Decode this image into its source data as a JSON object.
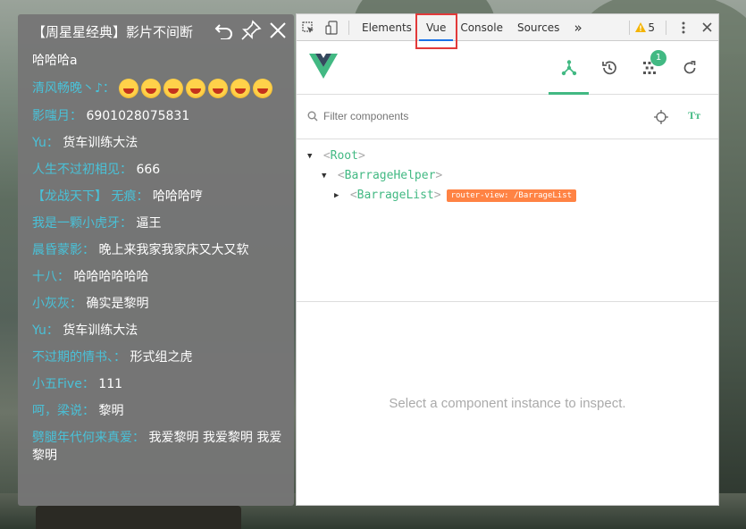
{
  "barrage": {
    "title": "【周星星经典】影片不间断",
    "messages": [
      {
        "user": "",
        "text": "哈哈哈a",
        "emojis": 0
      },
      {
        "user": "清风畅晚丶♪：",
        "text": "",
        "emojis": 7
      },
      {
        "user": "影嗤月：",
        "text": "6901028075831",
        "emojis": 0
      },
      {
        "user": "Yu：",
        "text": "货车训练大法",
        "emojis": 0
      },
      {
        "user": "人生不过初相见：",
        "text": "666",
        "emojis": 0
      },
      {
        "user": "【龙战天下】 无痕：",
        "text": "哈哈哈哼",
        "emojis": 0
      },
      {
        "user": "我是一颗小虎牙：",
        "text": "逼王",
        "emojis": 0
      },
      {
        "user": "晨昏蒙影：",
        "text": "晚上来我家我家床又大又软",
        "emojis": 0
      },
      {
        "user": "十八：",
        "text": "哈哈哈哈哈哈",
        "emojis": 0
      },
      {
        "user": "小灰灰：",
        "text": "确实是黎明",
        "emojis": 0
      },
      {
        "user": "Yu：",
        "text": "货车训练大法",
        "emojis": 0
      },
      {
        "user": "不过期的情书、：",
        "text": "形式组之虎",
        "emojis": 0
      },
      {
        "user": "小五Five：",
        "text": "111",
        "emojis": 0
      },
      {
        "user": "呵，梁说：",
        "text": "黎明",
        "emojis": 0
      },
      {
        "user": "劈腿年代何来真爱：",
        "text": "我爱黎明 我爱黎明 我爱黎明",
        "emojis": 0
      }
    ]
  },
  "devtools": {
    "tabs": [
      "Elements",
      "Vue",
      "Console",
      "Sources"
    ],
    "active_tab": "Vue",
    "more": "»",
    "warnings": "5",
    "timeline_badge": "1",
    "filter_placeholder": "Filter components",
    "font_toggle": "Tт",
    "tree": [
      {
        "name": "Root",
        "depth": 0,
        "expanded": true
      },
      {
        "name": "BarrageHelper",
        "depth": 1,
        "expanded": true
      },
      {
        "name": "BarrageList",
        "depth": 2,
        "expanded": false,
        "tag": "router-view: /BarrageList"
      }
    ],
    "inspect_hint": "Select a component instance to inspect."
  },
  "colors": {
    "vue_green": "#42b983",
    "username": "#49c2d9",
    "highlight": "#e23a3a",
    "route_tag": "#ff8344"
  }
}
